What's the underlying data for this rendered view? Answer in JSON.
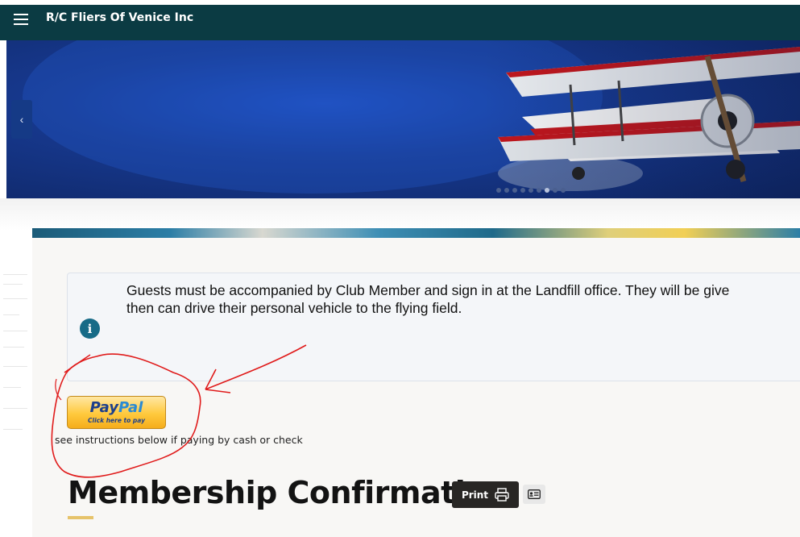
{
  "header": {
    "title": "R/C Fliers Of Venice Inc",
    "menu_icon": "hamburger-menu-icon"
  },
  "carousel": {
    "prev_icon": "chevron-left-icon",
    "prev_glyph": "‹",
    "dot_count": 9,
    "active_dot": 7
  },
  "alert": {
    "icon": "info-icon",
    "icon_glyph": "i",
    "line1": "Guests must be accompanied by Club Member and sign in at the Landfill office. They will be give",
    "line2": "then can drive their personal vehicle to the flying field."
  },
  "paypal": {
    "logo_part1": "Pay",
    "logo_part2": "Pal",
    "sub_label": "Click here to pay"
  },
  "instructions": "see instructions below if paying by cash or check",
  "page_title": "Membership Confirmation",
  "toolbar": {
    "print_label": "Print",
    "print_icon": "printer-icon",
    "card_icon": "id-card-icon"
  },
  "colors": {
    "topbar": "#0b3b43",
    "info_icon": "#176b87",
    "accent_line": "#e6c36a",
    "print_button": "#282624",
    "annotation_red": "#e01b1b"
  }
}
